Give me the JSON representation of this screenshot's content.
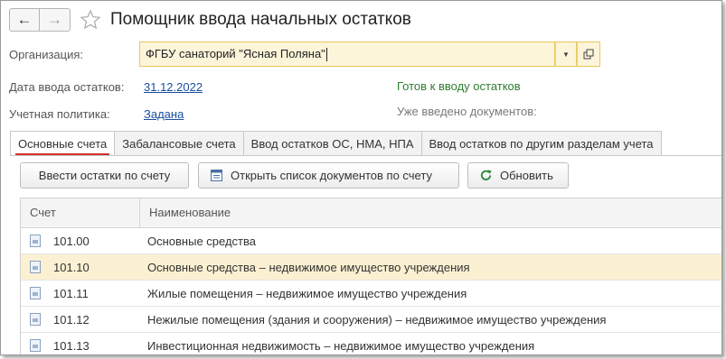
{
  "window": {
    "title": "Помощник ввода начальных остатков",
    "back_icon": "←",
    "forward_icon": "→"
  },
  "form": {
    "org_label": "Организация:",
    "org_value": "ФГБУ санаторий \"Ясная Поляна\"",
    "date_label": "Дата ввода остатков:",
    "date_value": "31.12.2022",
    "policy_label": "Учетная политика:",
    "policy_value": "Задана",
    "status_ready": "Готов к вводу остатков",
    "docs_entered_label": "Уже введено документов:"
  },
  "tabs": [
    {
      "label": "Основные счета",
      "active": true
    },
    {
      "label": "Забалансовые счета",
      "active": false
    },
    {
      "label": "Ввод остатков ОС, НМА, НПА",
      "active": false
    },
    {
      "label": "Ввод остатков по другим разделам учета",
      "active": false
    }
  ],
  "toolbar": {
    "enter_balances": "Ввести остатки по счету",
    "open_docs": "Открыть список документов по счету",
    "refresh": "Обновить"
  },
  "table": {
    "columns": [
      "Счет",
      "Наименование"
    ],
    "rows": [
      {
        "account": "101.00",
        "name": "Основные средства",
        "selected": false
      },
      {
        "account": "101.10",
        "name": "Основные средства – недвижимое имущество учреждения",
        "selected": true
      },
      {
        "account": "101.11",
        "name": "Жилые помещения – недвижимое имущество учреждения",
        "selected": false
      },
      {
        "account": "101.12",
        "name": "Нежилые помещения (здания и сооружения) – недвижимое имущество учреждения",
        "selected": false
      },
      {
        "account": "101.13",
        "name": "Инвестиционная недвижимость – недвижимое имущество учреждения",
        "selected": false
      }
    ]
  },
  "colors": {
    "accent_red": "#d32f2f",
    "link_blue": "#1a4fa0",
    "status_green": "#2f7d32",
    "selection": "#fbf1d2",
    "input_bg": "#fdf5d9"
  }
}
